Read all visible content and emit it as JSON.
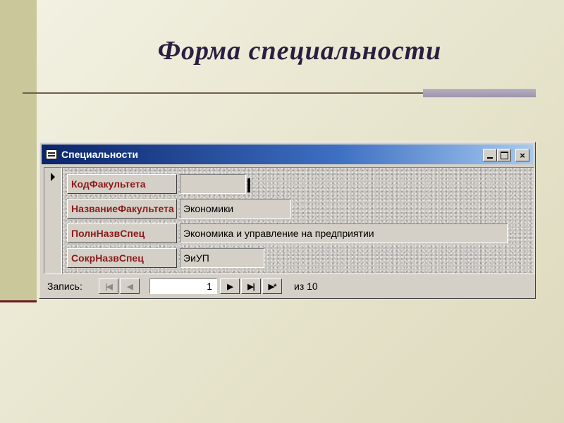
{
  "slide": {
    "title": "Форма специальности"
  },
  "window": {
    "title": "Специальности",
    "icon": "form-icon",
    "buttons": {
      "minimize": "minimize-icon",
      "maximize": "maximize-icon",
      "close": "×"
    }
  },
  "form": {
    "fields": [
      {
        "label": "КодФакультета",
        "value": ""
      },
      {
        "label": "НазваниеФакультета",
        "value": "Экономики"
      },
      {
        "label": "ПолнНазвСпец",
        "value": "Экономика и управление на предприятии"
      },
      {
        "label": "СокрНазвСпец",
        "value": "ЭиУП"
      }
    ]
  },
  "navigation": {
    "label": "Запись:",
    "first": "|◀",
    "prev": "◀",
    "current_record": "1",
    "next": "▶",
    "last": "▶|",
    "new": "▶*",
    "of_text": "из 10"
  },
  "colors": {
    "titlebar_start": "#0a246a",
    "titlebar_end": "#a6caf0",
    "label_text": "#8b1a1a",
    "slide_title": "#2a1f40"
  }
}
